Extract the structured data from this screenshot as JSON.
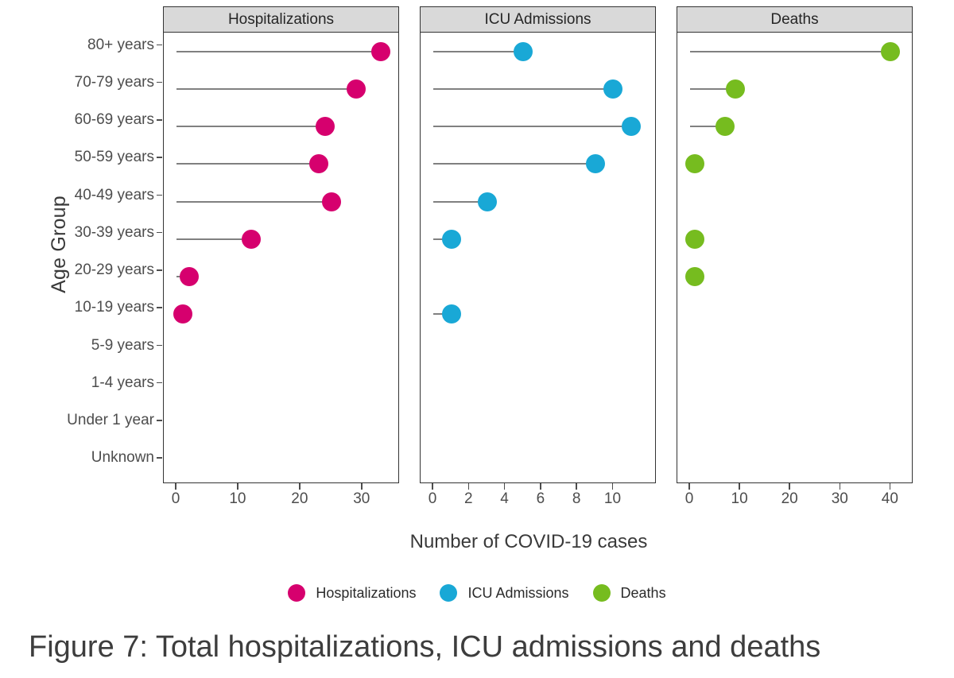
{
  "figure": {
    "caption": "Figure 7: Total hospitalizations, ICU admissions and deaths",
    "x_axis_title": "Number of COVID-19 cases",
    "y_axis_title": "Age Group"
  },
  "colors": {
    "hospitalizations": "#D6006E",
    "icu_admissions": "#19A8D6",
    "deaths": "#76BC1F",
    "lollipop_line": "#808080",
    "panel_strip": "#D9D9D9",
    "panel_border": "#333333",
    "axis_text": "#4D4D4D"
  },
  "legend": {
    "position": "bottom",
    "items": [
      {
        "label": "Hospitalizations",
        "color": "#D6006E",
        "icon": "circle-marker-icon"
      },
      {
        "label": "ICU Admissions",
        "color": "#19A8D6",
        "icon": "circle-marker-icon"
      },
      {
        "label": "Deaths",
        "color": "#76BC1F",
        "icon": "circle-marker-icon"
      }
    ]
  },
  "chart_data": {
    "type": "bar",
    "subtype": "lollipop-dot-plot-faceted",
    "title": "",
    "xlabel": "Number of COVID-19 cases",
    "ylabel": "Age Group",
    "grid": false,
    "legend_position": "bottom",
    "categories": [
      "80+ years",
      "70-79 years",
      "60-69 years",
      "50-59 years",
      "40-49 years",
      "30-39 years",
      "20-29 years",
      "10-19 years",
      "5-9 years",
      "1-4 years",
      "Under 1 year",
      "Unknown"
    ],
    "panels": [
      {
        "title": "Hospitalizations",
        "color": "#D6006E",
        "xlim": [
          0,
          34
        ],
        "xticks": [
          0,
          10,
          20,
          30
        ],
        "values": [
          33,
          29,
          24,
          23,
          25,
          12,
          2,
          1,
          null,
          null,
          null,
          null
        ]
      },
      {
        "title": "ICU Admissions",
        "color": "#19A8D6",
        "xlim": [
          0,
          11.7
        ],
        "xticks": [
          0,
          2,
          4,
          6,
          8,
          10
        ],
        "values": [
          5,
          10,
          11,
          9,
          3,
          1,
          null,
          1,
          null,
          null,
          null,
          null
        ]
      },
      {
        "title": "Deaths",
        "color": "#76BC1F",
        "xlim": [
          0,
          42
        ],
        "xticks": [
          0,
          10,
          20,
          30,
          40
        ],
        "values": [
          40,
          9,
          7,
          1,
          null,
          1,
          1,
          null,
          null,
          null,
          null,
          null
        ]
      }
    ],
    "series": [
      {
        "name": "Hospitalizations",
        "values": [
          33,
          29,
          24,
          23,
          25,
          12,
          2,
          1,
          null,
          null,
          null,
          null
        ]
      },
      {
        "name": "ICU Admissions",
        "values": [
          5,
          10,
          11,
          9,
          3,
          1,
          null,
          1,
          null,
          null,
          null,
          null
        ]
      },
      {
        "name": "Deaths",
        "values": [
          40,
          9,
          7,
          1,
          null,
          1,
          1,
          null,
          null,
          null,
          null,
          null
        ]
      }
    ]
  }
}
